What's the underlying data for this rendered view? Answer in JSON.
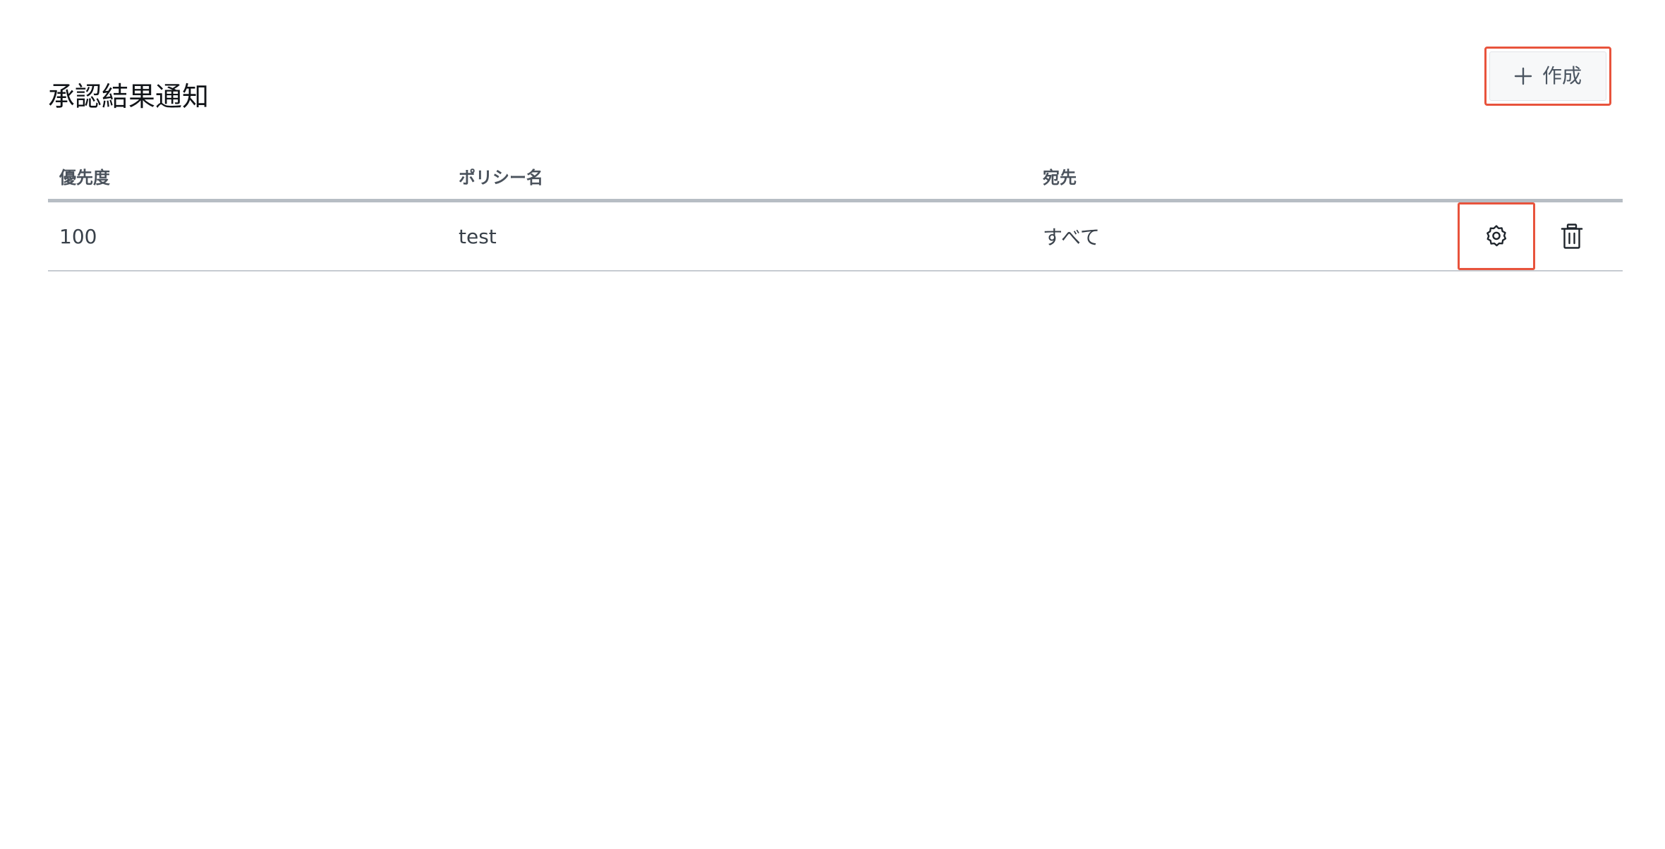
{
  "page": {
    "title": "承認結果通知"
  },
  "toolbar": {
    "create_label": "作成",
    "create_icon": "plus-icon"
  },
  "table": {
    "columns": [
      "優先度",
      "ポリシー名",
      "宛先"
    ],
    "rows": [
      {
        "priority": "100",
        "policy_name": "test",
        "destination": "すべて",
        "actions": [
          "gear-icon",
          "trash-icon"
        ]
      }
    ]
  },
  "colors": {
    "highlight": "#e8533c",
    "header_rule": "#b7bdc4",
    "row_rule": "#c6cbd1"
  }
}
